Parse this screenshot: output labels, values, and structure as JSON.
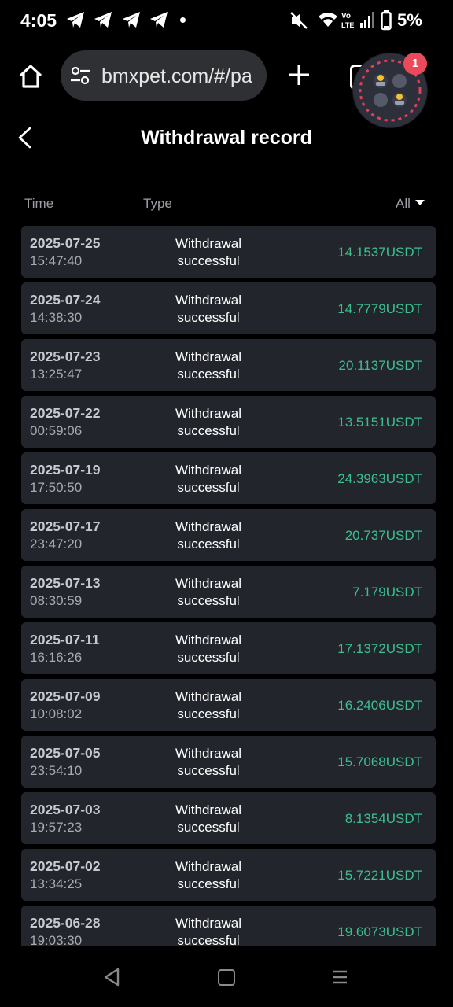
{
  "status_bar": {
    "time": "4:05",
    "battery": "5%",
    "icons": [
      "telegram-icon",
      "telegram-icon",
      "telegram-icon",
      "telegram-icon",
      "notification-dot",
      "mute-icon",
      "wifi-icon",
      "volte-icon",
      "signal-icon",
      "battery-icon"
    ]
  },
  "browser": {
    "url": "bmxpet.com/#/pa",
    "notification_count": "1"
  },
  "page": {
    "title": "Withdrawal record",
    "columns": {
      "time": "Time",
      "type": "Type"
    },
    "filter_label": "All"
  },
  "records": [
    {
      "date": "2025-07-25",
      "time": "15:47:40",
      "type_line1": "Withdrawal",
      "type_line2": "successful",
      "amount": "14.1537USDT"
    },
    {
      "date": "2025-07-24",
      "time": "14:38:30",
      "type_line1": "Withdrawal",
      "type_line2": "successful",
      "amount": "14.7779USDT"
    },
    {
      "date": "2025-07-23",
      "time": "13:25:47",
      "type_line1": "Withdrawal",
      "type_line2": "successful",
      "amount": "20.1137USDT"
    },
    {
      "date": "2025-07-22",
      "time": "00:59:06",
      "type_line1": "Withdrawal",
      "type_line2": "successful",
      "amount": "13.5151USDT"
    },
    {
      "date": "2025-07-19",
      "time": "17:50:50",
      "type_line1": "Withdrawal",
      "type_line2": "successful",
      "amount": "24.3963USDT"
    },
    {
      "date": "2025-07-17",
      "time": "23:47:20",
      "type_line1": "Withdrawal",
      "type_line2": "successful",
      "amount": "20.737USDT"
    },
    {
      "date": "2025-07-13",
      "time": "08:30:59",
      "type_line1": "Withdrawal",
      "type_line2": "successful",
      "amount": "7.179USDT"
    },
    {
      "date": "2025-07-11",
      "time": "16:16:26",
      "type_line1": "Withdrawal",
      "type_line2": "successful",
      "amount": "17.1372USDT"
    },
    {
      "date": "2025-07-09",
      "time": "10:08:02",
      "type_line1": "Withdrawal",
      "type_line2": "successful",
      "amount": "16.2406USDT"
    },
    {
      "date": "2025-07-05",
      "time": "23:54:10",
      "type_line1": "Withdrawal",
      "type_line2": "successful",
      "amount": "15.7068USDT"
    },
    {
      "date": "2025-07-03",
      "time": "19:57:23",
      "type_line1": "Withdrawal",
      "type_line2": "successful",
      "amount": "8.1354USDT"
    },
    {
      "date": "2025-07-02",
      "time": "13:34:25",
      "type_line1": "Withdrawal",
      "type_line2": "successful",
      "amount": "15.7221USDT"
    },
    {
      "date": "2025-06-28",
      "time": "19:03:30",
      "type_line1": "Withdrawal",
      "type_line2": "successful",
      "amount": "19.6073USDT"
    }
  ],
  "colors": {
    "background": "#000000",
    "card": "#23252d",
    "amount_green": "#3bbf8f",
    "badge_red": "#ea4a5a"
  }
}
